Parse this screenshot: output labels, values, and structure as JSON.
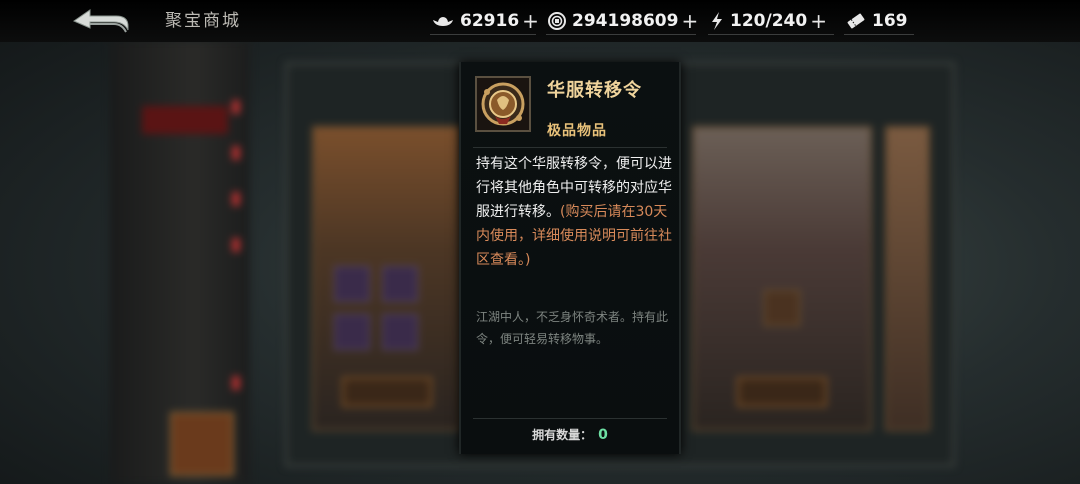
{
  "page": {
    "title": "聚宝商城"
  },
  "resources": [
    {
      "icon": "silver-ingot-icon",
      "value": "62916"
    },
    {
      "icon": "copper-coin-icon",
      "value": "294198609"
    },
    {
      "icon": "stamina-bolt-icon",
      "value": "120/240"
    },
    {
      "icon": "ticket-icon",
      "value": "169"
    }
  ],
  "item_tooltip": {
    "name": "华服转移令",
    "grade": "极品物品",
    "description_main": "持有这个华服转移令，便可以进行将其他角色中可转移的对应华服进行转移。",
    "description_note": "(购买后请在30天内使用，详细使用说明可前往社区查看。)",
    "flavor": "江湖中人，不乏身怀奇术者。持有此令，便可轻易转移物事。",
    "owned_label": "拥有数量：",
    "owned_count": "0"
  },
  "colors": {
    "item_name": "#f0d49c",
    "grade": "#e9c27a",
    "note": "#d88a5a",
    "owned_count": "#6ee0a4"
  }
}
